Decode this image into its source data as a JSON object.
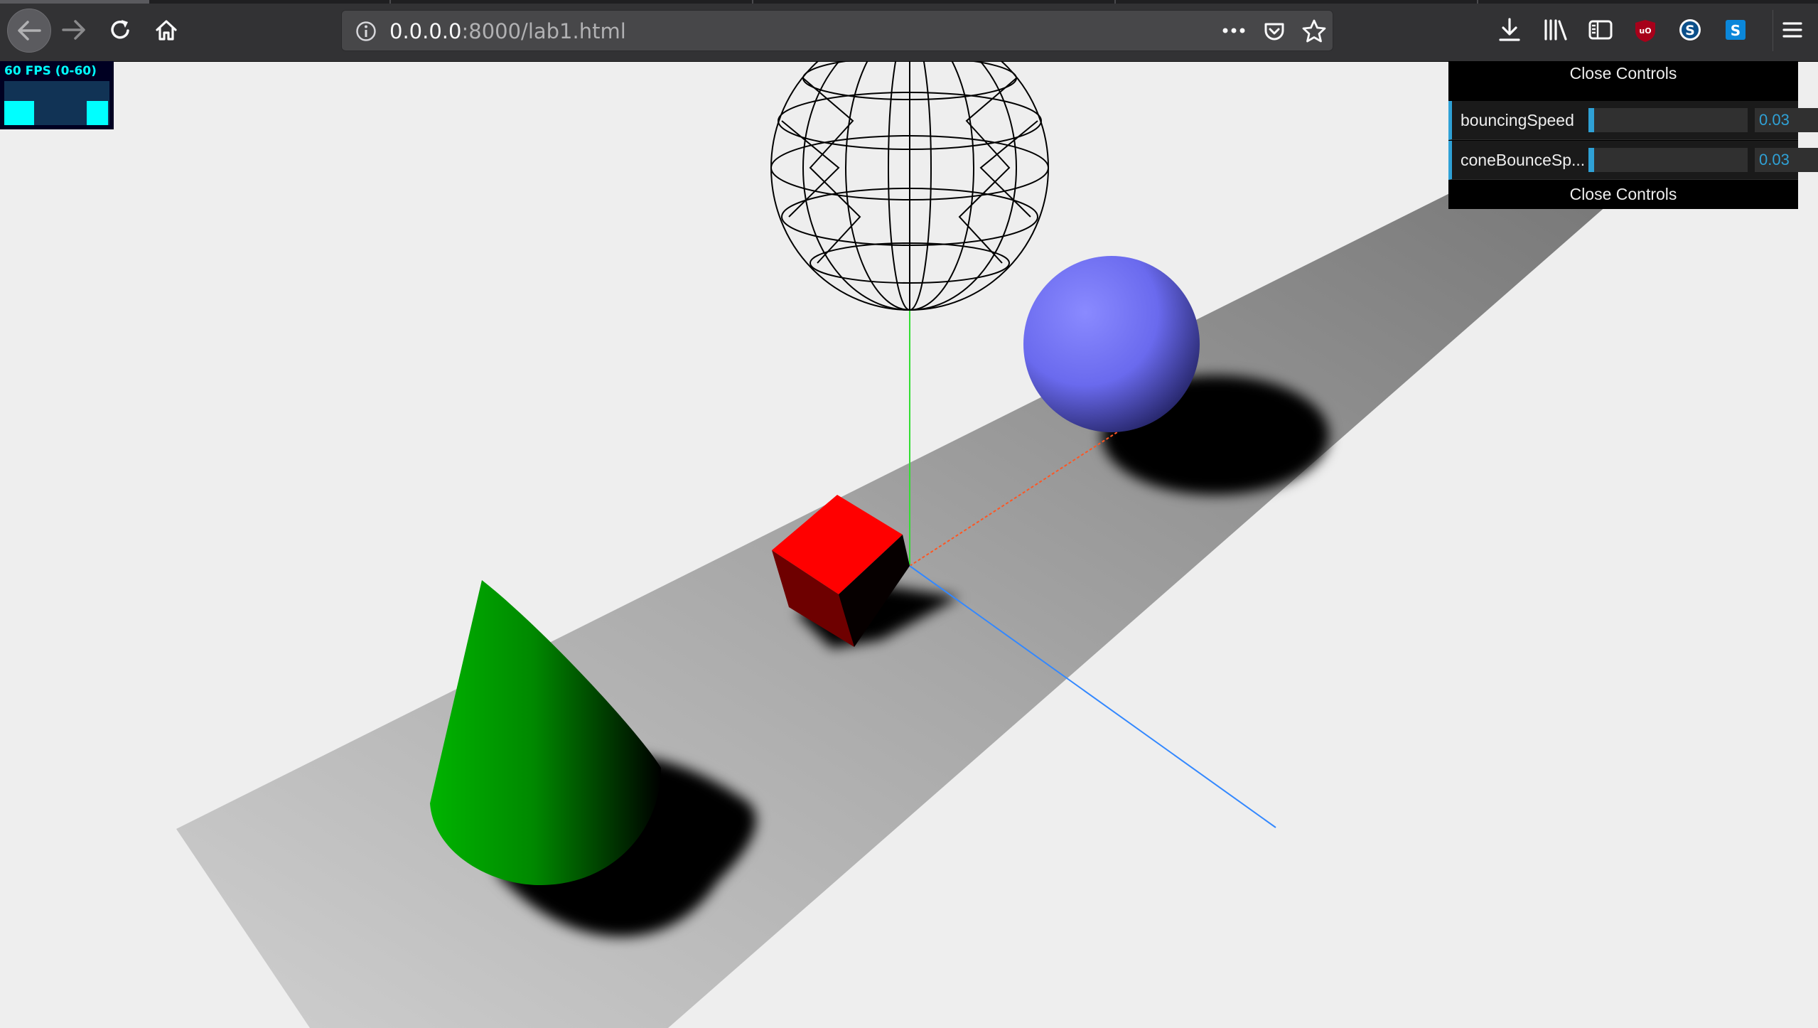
{
  "browser": {
    "url_host": "0.0.0.0",
    "url_path": ":8000/lab1.html",
    "icons": {
      "back": "back-arrow-icon",
      "forward": "forward-arrow-icon",
      "reload": "reload-icon",
      "home": "home-icon",
      "site_info": "info-icon",
      "page_actions": "more-dots-icon",
      "pocket": "pocket-icon",
      "bookmark": "star-icon",
      "downloads": "download-icon",
      "library": "library-icon",
      "sidebar": "sidebar-icon",
      "ublock": "ublock-icon",
      "extension_s1": "s-circle-icon",
      "extension_s2": "s-square-icon",
      "menu": "hamburger-menu-icon"
    },
    "colors": {
      "toolbar": "#323234",
      "urlbar": "#474749",
      "ublock": "#a7001a",
      "ext_blue": "#0b87da"
    }
  },
  "stats": {
    "label": "60 FPS (0-60)",
    "color": "#00ffff"
  },
  "gui": {
    "close_label": "Close Controls",
    "controls": [
      {
        "label": "bouncingSpeed",
        "value": "0.03",
        "fill": 0.03
      },
      {
        "label": "coneBounceSp...",
        "value": "0.03",
        "fill": 0.03
      }
    ],
    "accent": "#2fa1d6"
  },
  "scene": {
    "objects": [
      "plane",
      "cone",
      "cube",
      "sphere",
      "wireframe-sphere",
      "axes-helper"
    ],
    "colors": {
      "plane": "#a9a9a9",
      "cone": "#00a000",
      "cube": "#ff0000",
      "sphere": "#7777ff",
      "wireframe": "#000000",
      "axis_x": "#ff5522",
      "axis_y": "#33dd33",
      "axis_z": "#3388ff",
      "background": "#eeeeee"
    }
  }
}
